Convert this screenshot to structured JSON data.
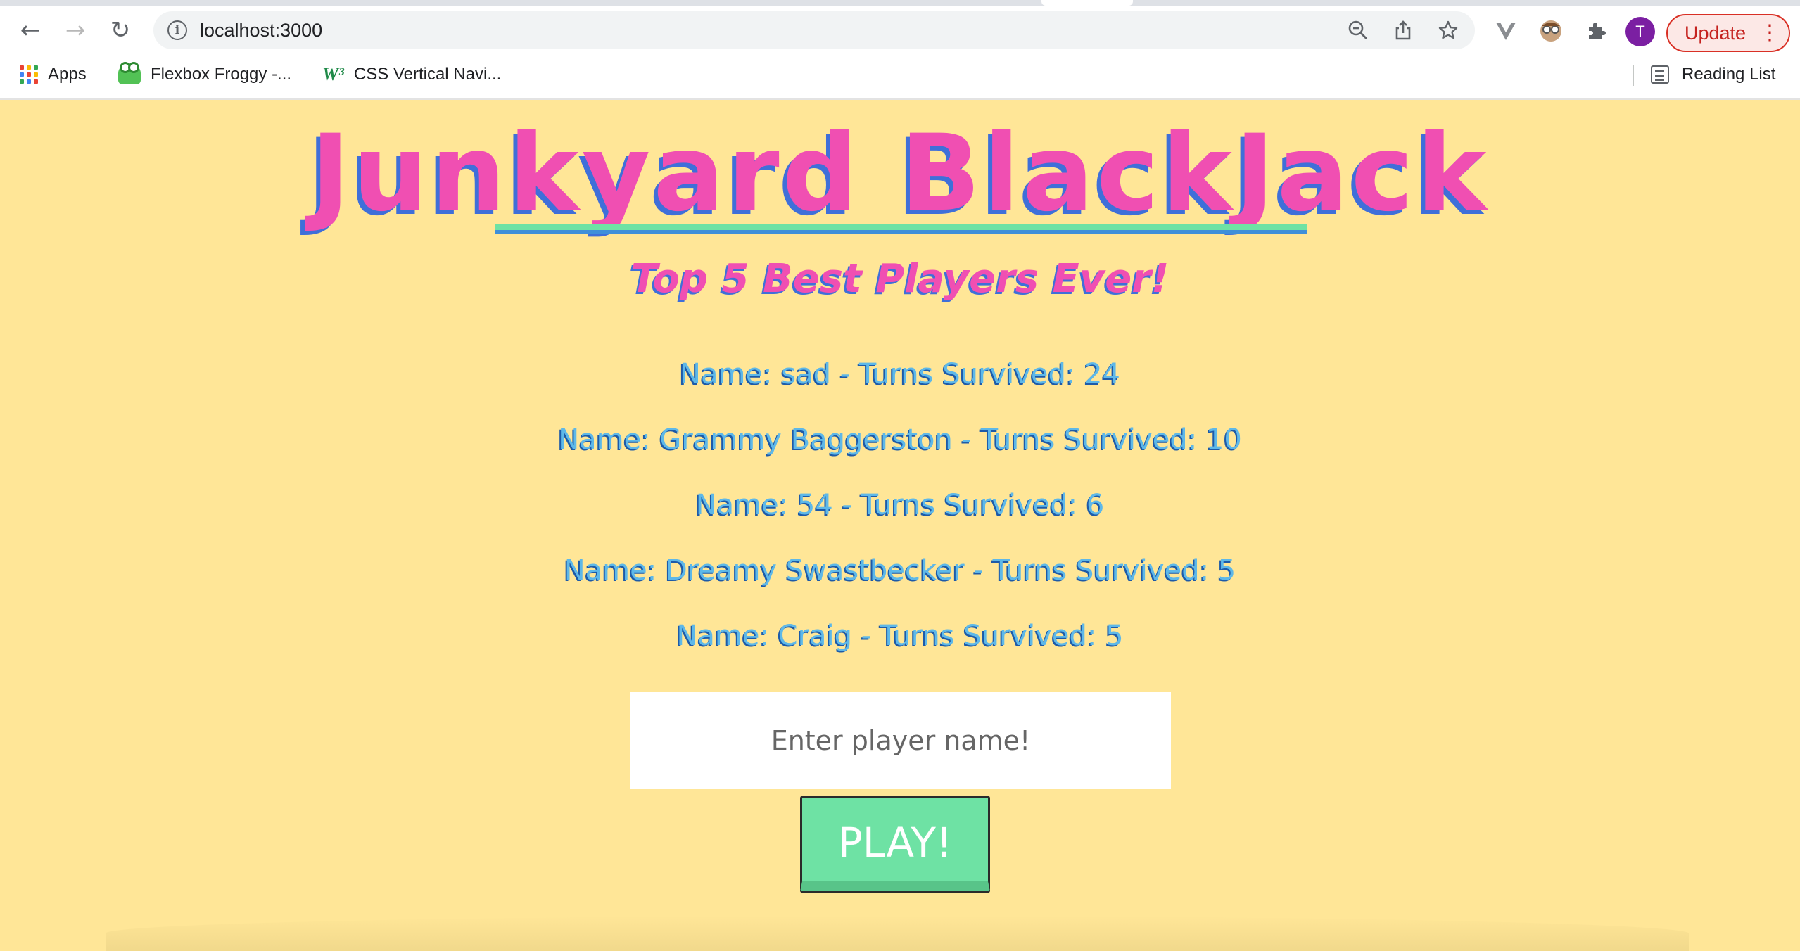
{
  "browser": {
    "url": "localhost:3000",
    "update_label": "Update",
    "profile_initial": "T",
    "bookmarks": [
      {
        "label": "Apps",
        "icon": "apps-grid-icon"
      },
      {
        "label": "Flexbox Froggy -...",
        "icon": "frog-icon"
      },
      {
        "label": "CSS Vertical Navi...",
        "icon": "w3-icon"
      }
    ],
    "reading_list_label": "Reading List"
  },
  "game": {
    "title": "Junkyard BlackJack",
    "subtitle": "Top 5 Best Players Ever!",
    "leaderboard": [
      "Name: sad - Turns Survived: 24",
      "Name: Grammy Baggerston - Turns Survived: 10",
      "Name: 54 - Turns Survived: 6",
      "Name: Dreamy Swastbecker - Turns Survived: 5",
      "Name: Craig - Turns Survived: 5"
    ],
    "name_input": {
      "placeholder": "Enter player name!",
      "value": ""
    },
    "play_label": "PLAY!"
  },
  "colors": {
    "page_background": "#ffe697",
    "title_pink": "#f04fb2",
    "title_shadow_blue": "#3f6fd9",
    "leaderboard_blue": "#5eb8e8",
    "button_green": "#6ee2a4",
    "update_red": "#c5221f"
  }
}
